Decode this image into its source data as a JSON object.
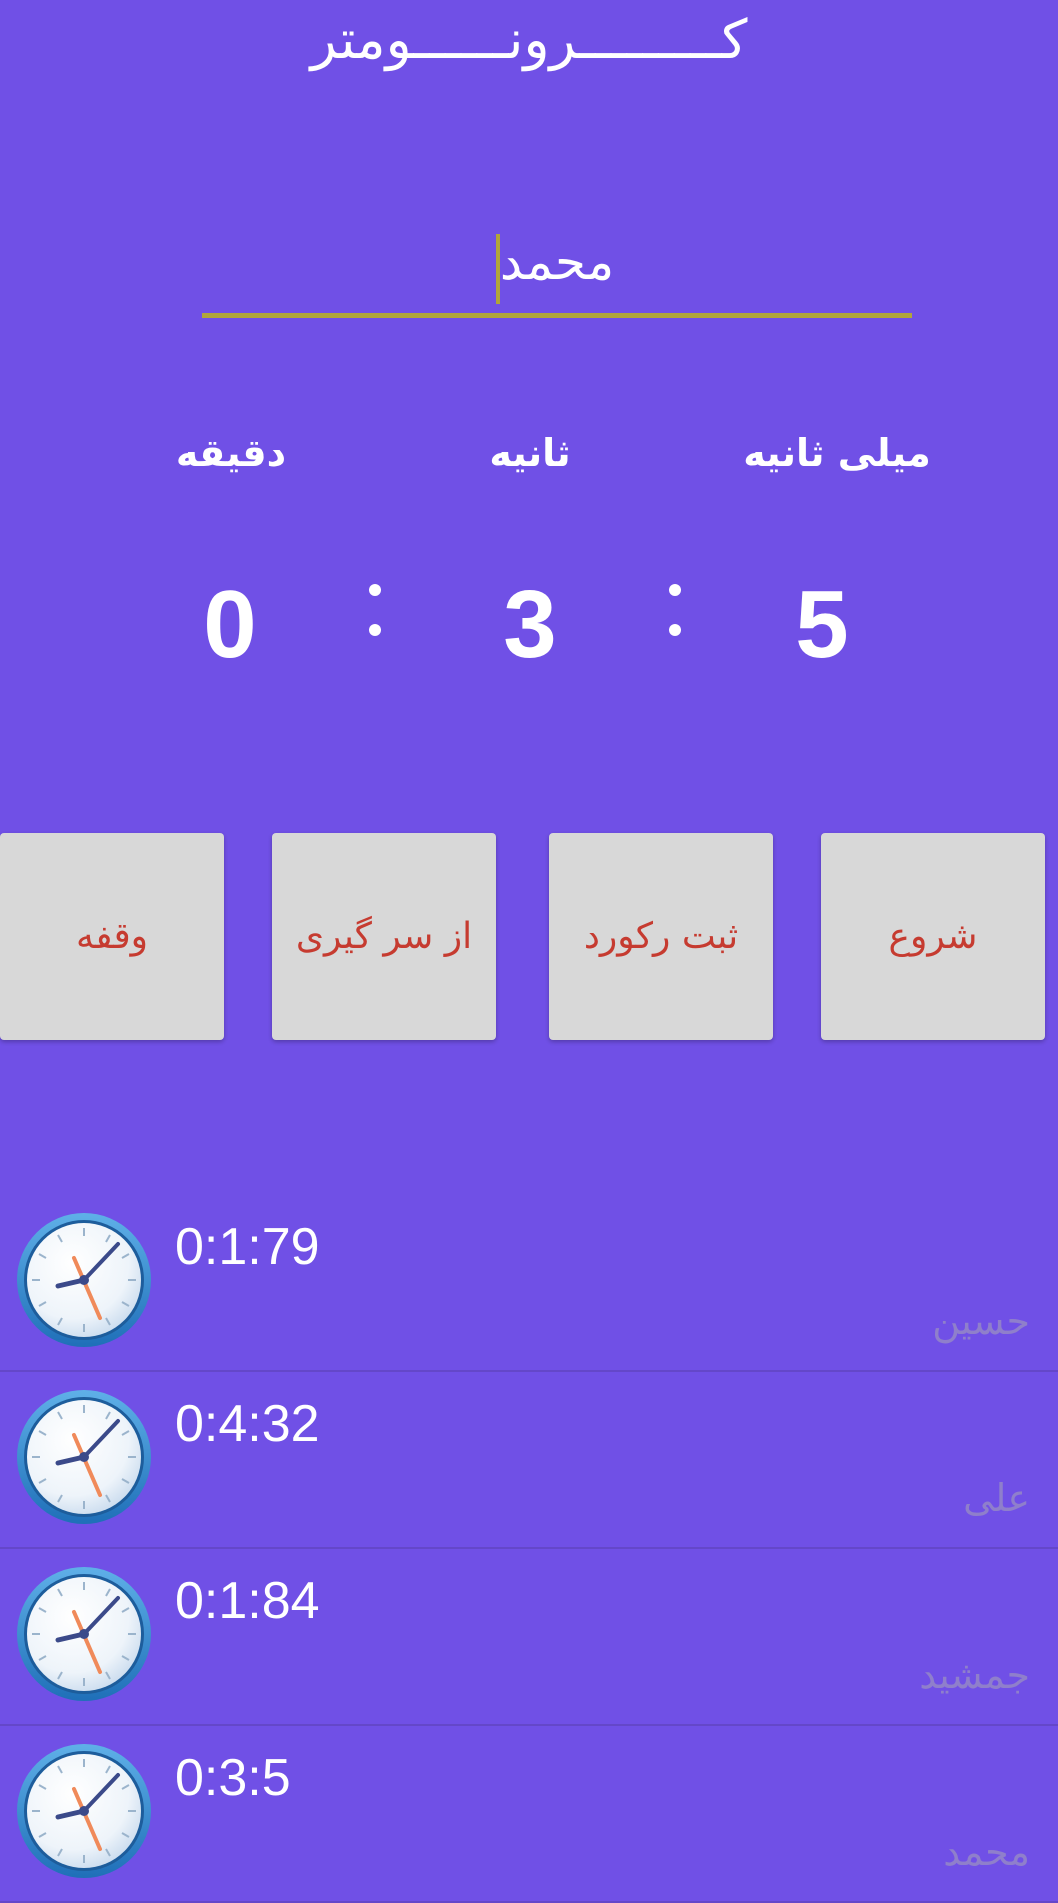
{
  "app": {
    "title": "کـــــــــرونــــــومتر"
  },
  "name_input": {
    "value": "محمد"
  },
  "units": {
    "minutes": "دقیقه",
    "seconds": "ثانیه",
    "milliseconds": "میلی ثانیه"
  },
  "display": {
    "minutes": "0",
    "seconds": "3",
    "milliseconds": "5"
  },
  "buttons": {
    "start": "شروع",
    "record": "ثبت رکورد",
    "reset": "از سر گیری",
    "pause": "وقفه"
  },
  "records": [
    {
      "time": "0:1:79",
      "name": "حسین",
      "icon": "clock-icon"
    },
    {
      "time": "0:4:32",
      "name": "علی",
      "icon": "clock-icon"
    },
    {
      "time": "0:1:84",
      "name": "جمشید",
      "icon": "clock-icon"
    },
    {
      "time": "0:3:5",
      "name": "محمد",
      "icon": "clock-icon"
    }
  ],
  "colors": {
    "background": "#7050e6",
    "button_background": "#d8d8d8",
    "button_text": "#c63b30",
    "input_underline": "#b1a53a",
    "record_name": "#8f7fcb"
  }
}
